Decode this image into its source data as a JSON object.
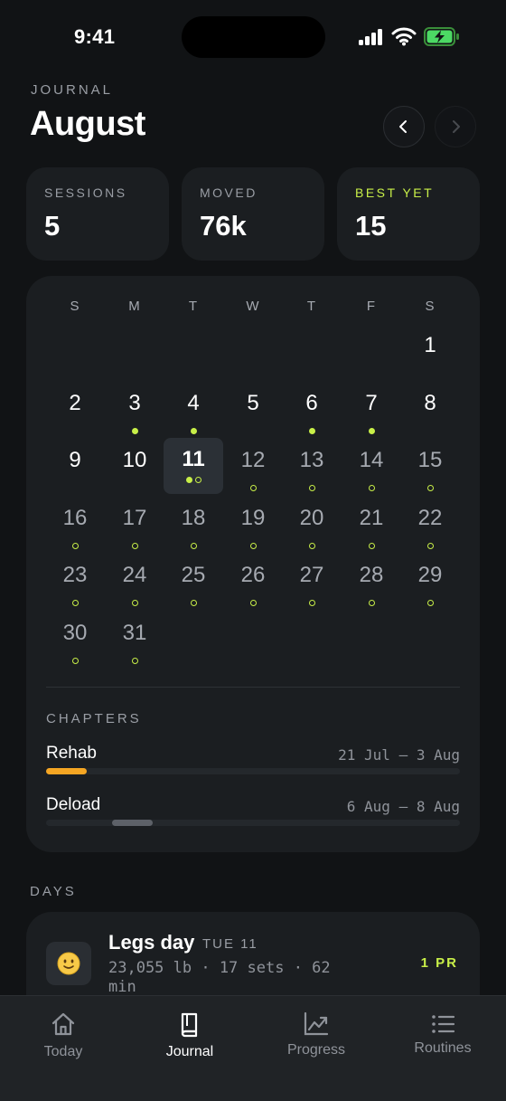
{
  "status_bar": {
    "time": "9:41"
  },
  "header": {
    "kicker": "JOURNAL",
    "month": "August"
  },
  "stats": [
    {
      "label": "SESSIONS",
      "value": "5"
    },
    {
      "label": "MOVED",
      "value": "76k"
    },
    {
      "label": "BEST YET",
      "value": "15"
    }
  ],
  "calendar": {
    "weekdays": [
      "S",
      "M",
      "T",
      "W",
      "T",
      "F",
      "S"
    ],
    "days": [
      {
        "d": "1"
      },
      {
        "d": "2"
      },
      {
        "d": "3"
      },
      {
        "d": "4"
      },
      {
        "d": "5"
      },
      {
        "d": "6"
      },
      {
        "d": "7"
      },
      {
        "d": "8"
      },
      {
        "d": "9"
      },
      {
        "d": "10"
      },
      {
        "d": "11"
      },
      {
        "d": "12"
      },
      {
        "d": "13"
      },
      {
        "d": "14"
      },
      {
        "d": "15"
      },
      {
        "d": "16"
      },
      {
        "d": "17"
      },
      {
        "d": "18"
      },
      {
        "d": "19"
      },
      {
        "d": "20"
      },
      {
        "d": "21"
      },
      {
        "d": "22"
      },
      {
        "d": "23"
      },
      {
        "d": "24"
      },
      {
        "d": "25"
      },
      {
        "d": "26"
      },
      {
        "d": "27"
      },
      {
        "d": "28"
      },
      {
        "d": "29"
      },
      {
        "d": "30"
      },
      {
        "d": "31"
      }
    ]
  },
  "chapters": {
    "label": "CHAPTERS",
    "items": [
      {
        "name": "Rehab",
        "range": "21 Jul — 3 Aug",
        "color": "#f5a623"
      },
      {
        "name": "Deload",
        "range": "6 Aug — 8 Aug",
        "color": "#5d6168"
      }
    ]
  },
  "days_section": {
    "label": "DAYS",
    "entries": [
      {
        "emoji": "🙂",
        "title": "Legs day",
        "tag": "TUE 11",
        "meta": "23,055 lb · 17 sets · 62 min",
        "badge": "1 PR"
      }
    ]
  },
  "tabs": [
    {
      "label": "Today",
      "icon": "home-icon"
    },
    {
      "label": "Journal",
      "icon": "book-icon"
    },
    {
      "label": "Progress",
      "icon": "chart-icon"
    },
    {
      "label": "Routines",
      "icon": "list-icon"
    }
  ],
  "colors": {
    "accent": "#c8ef48",
    "background": "#111315",
    "card": "#1b1e21"
  }
}
